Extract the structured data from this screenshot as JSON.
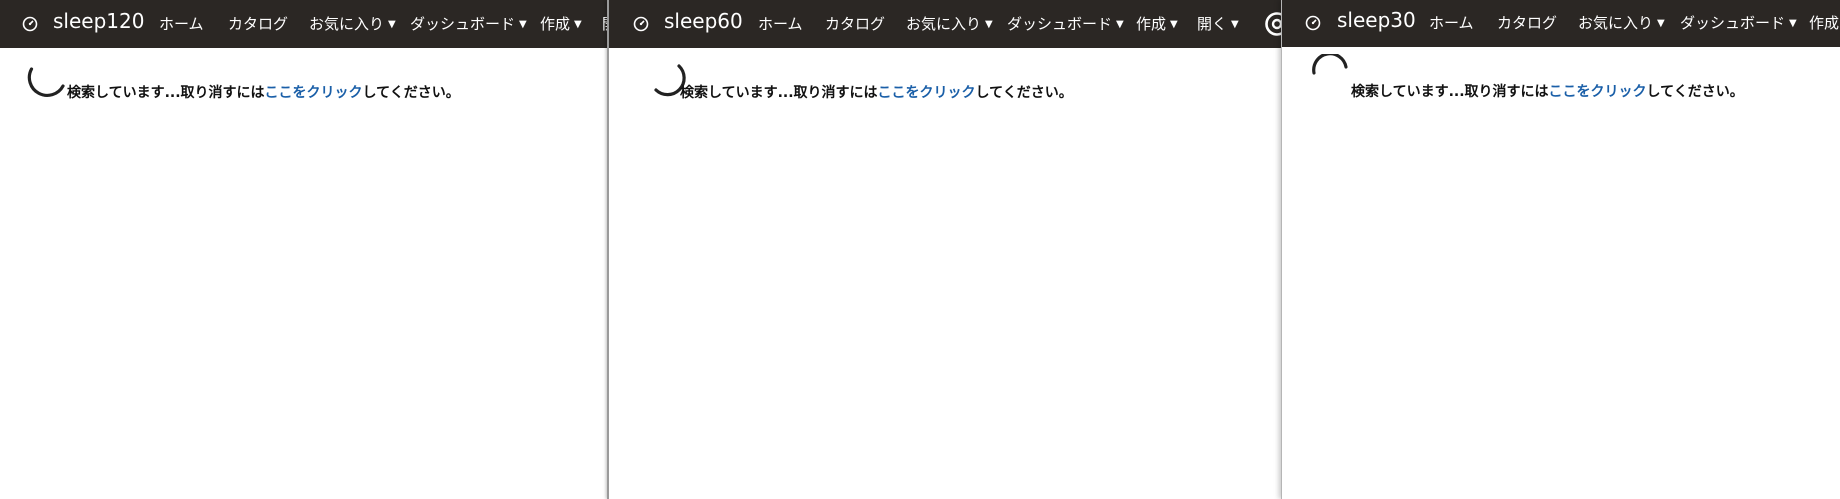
{
  "windows": [
    {
      "app_title": "sleep120",
      "nav": {
        "home": "ホーム",
        "catalog": "カタログ",
        "favorites": "お気に入り",
        "dashboard": "ダッシュボード",
        "create": "作成",
        "open": "開"
      },
      "status": {
        "before": "検索しています...取り消すには",
        "link": "ここをクリック",
        "after": "してください。"
      }
    },
    {
      "app_title": "sleep60",
      "nav": {
        "home": "ホーム",
        "catalog": "カタログ",
        "favorites": "お気に入り",
        "dashboard": "ダッシュボード",
        "create": "作成",
        "open": "開く"
      },
      "status": {
        "before": "検索しています...取り消すには",
        "link": "ここをクリック",
        "after": "してください。"
      }
    },
    {
      "app_title": "sleep30",
      "nav": {
        "home": "ホーム",
        "catalog": "カタログ",
        "favorites": "お気に入り",
        "dashboard": "ダッシュボード",
        "create": "作成"
      },
      "status": {
        "before": "検索しています...取り消すには",
        "link": "ここをクリック",
        "after": "してください。"
      }
    }
  ],
  "colors": {
    "navbar": "#2b2724",
    "link": "#1a5fa8",
    "spinner": "#222222"
  },
  "icons": {
    "logo": "gauge-icon",
    "user": "user-account-icon",
    "dropdown": "caret-down-icon",
    "loading": "loading-spinner-icon"
  }
}
